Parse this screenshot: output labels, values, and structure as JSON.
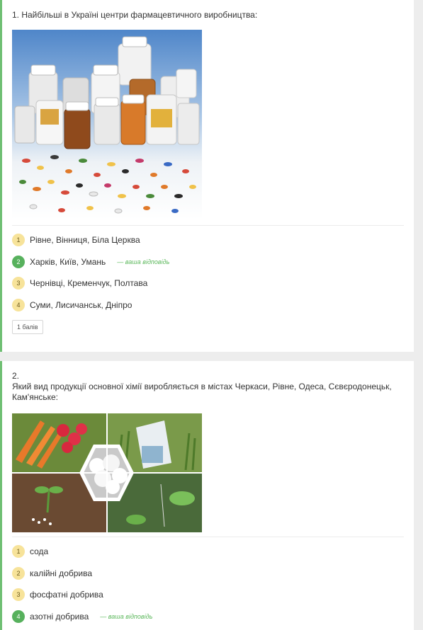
{
  "questions": [
    {
      "text": "1. Найбільші в Україні центри фармацевтичного виробництва:",
      "answers": [
        {
          "num": "1",
          "label": "Рівне, Вінниця, Біла Церква",
          "selected": false
        },
        {
          "num": "2",
          "label": "Харків, Київ, Умань",
          "selected": true
        },
        {
          "num": "3",
          "label": "Чернівці, Кременчук, Полтава",
          "selected": false
        },
        {
          "num": "4",
          "label": "Суми, Лисичанськ, Дніпро",
          "selected": false
        }
      ],
      "your_answer_note": "— ваша відповідь",
      "points": "1 балів"
    },
    {
      "number": "2.",
      "text": "Який вид продукції основної хімії виробляється в містах Черкаси, Рівне, Одеса, Сєвєродонецьк, Кам'янське:",
      "answers": [
        {
          "num": "1",
          "label": "сода",
          "selected": false
        },
        {
          "num": "2",
          "label": "калійні добрива",
          "selected": false
        },
        {
          "num": "3",
          "label": "фосфатні добрива",
          "selected": false
        },
        {
          "num": "4",
          "label": "азотні добрива",
          "selected": true
        }
      ],
      "your_answer_note": "— ваша відповідь"
    }
  ],
  "colors": {
    "accent_green": "#57b15d",
    "badge_yellow": "#f7e39a",
    "card_border": "#6fbf73"
  }
}
